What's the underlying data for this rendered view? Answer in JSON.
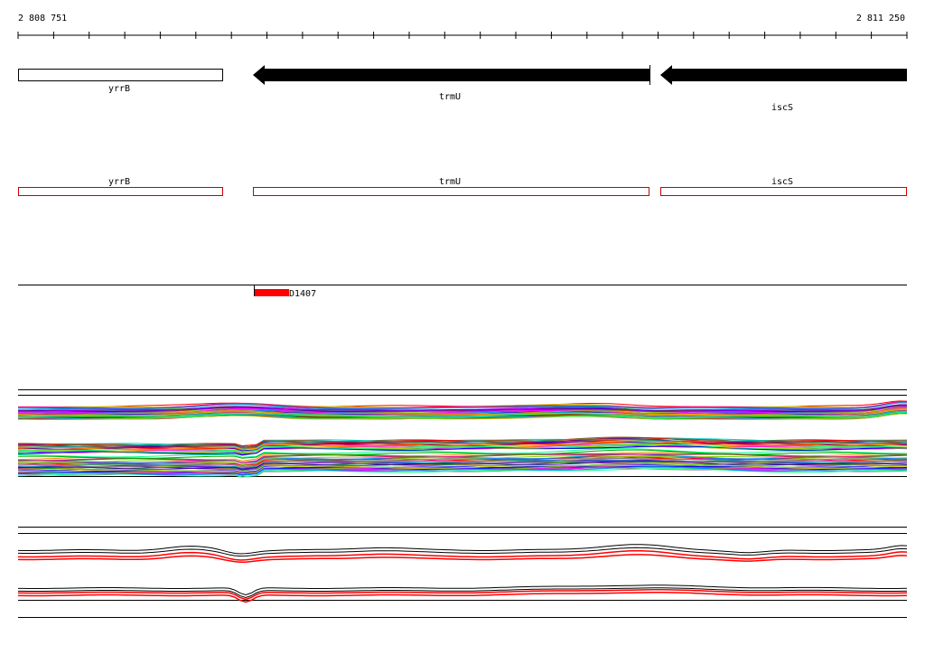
{
  "ruler": {
    "start_label": "2 808 751",
    "end_label": "2 811 250"
  },
  "genes": [
    {
      "name": "yrrB",
      "strand": "none"
    },
    {
      "name": "trmU",
      "strand": "reverse"
    },
    {
      "name": "iscS",
      "strand": "reverse"
    }
  ],
  "annotations": [
    {
      "name": "yrrB"
    },
    {
      "name": "trmU"
    },
    {
      "name": "iscS"
    }
  ],
  "feature": {
    "label": "D1407",
    "color": "#ff0000"
  },
  "colors": {
    "gene_fill": "#000000",
    "annotation_outline": "#cc0000",
    "feature": "#ff0000",
    "track_line": "#000000",
    "highlight_trace": "#ff0000"
  }
}
